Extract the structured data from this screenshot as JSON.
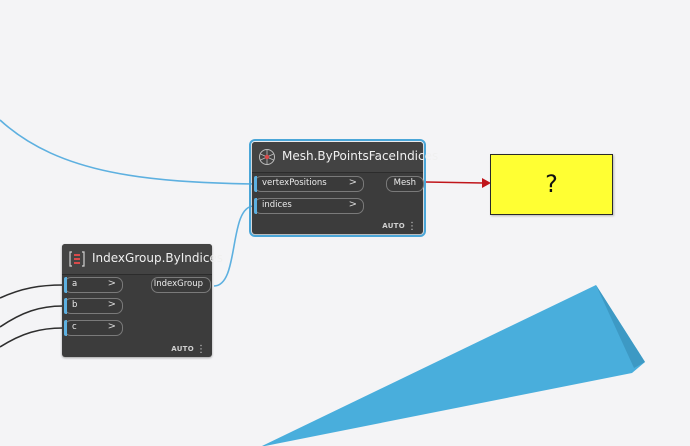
{
  "colors": {
    "canvas": "#f4f4f6",
    "node_body": "#3c3c3c",
    "wire": "#5db0e0",
    "wire_dark": "#2e2e2e",
    "arrow": "#c0151b",
    "unknown_box": "#ffff33",
    "wedge": "#49aedc"
  },
  "nodes": {
    "mesh": {
      "title": "Mesh.ByPointsFaceIndices",
      "icon": "mesh-icon",
      "inputs": [
        {
          "label": "vertexPositions",
          "chevron": ">"
        },
        {
          "label": "indices",
          "chevron": ">"
        }
      ],
      "output": "Mesh",
      "lacing": "AUTO",
      "menu": "⋮"
    },
    "indexgroup": {
      "title": "IndexGroup.ByIndices",
      "icon": "bracket-list-icon",
      "inputs": [
        {
          "label": "a",
          "chevron": ">"
        },
        {
          "label": "b",
          "chevron": ">"
        },
        {
          "label": "c",
          "chevron": ">"
        }
      ],
      "output": "IndexGroup",
      "lacing": "AUTO",
      "menu": "⋮"
    }
  },
  "unknown_output": {
    "label": "?"
  }
}
